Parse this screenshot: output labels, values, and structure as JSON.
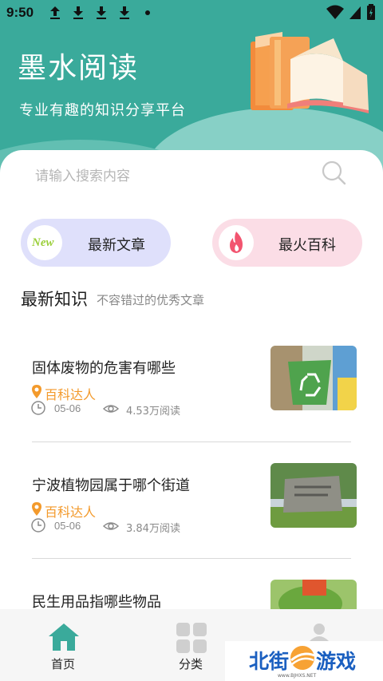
{
  "status_bar": {
    "time": "9:50"
  },
  "header": {
    "title": "墨水阅读",
    "slogan": "专业有趣的知识分享平台"
  },
  "search": {
    "placeholder": "请输入搜索内容"
  },
  "quick_links": [
    {
      "label": "最新文章",
      "badge": "New"
    },
    {
      "label": "最火百科"
    }
  ],
  "section": {
    "title": "最新知识",
    "subtitle": "不容错过的优秀文章"
  },
  "articles": [
    {
      "title": "固体废物的危害有哪些",
      "category": "百科达人",
      "date": "05-06",
      "reads": "4.53万阅读"
    },
    {
      "title": "宁波植物园属于哪个街道",
      "category": "百科达人",
      "date": "05-06",
      "reads": "3.84万阅读"
    },
    {
      "title": "民生用品指哪些物品"
    }
  ],
  "tabs": [
    {
      "label": "首页",
      "active": true
    },
    {
      "label": "分类"
    }
  ],
  "watermark": {
    "text1": "北街",
    "text2": "游戏",
    "url": "www.BJHXS.NET"
  },
  "colors": {
    "accent": "#3aaa9b",
    "category": "#f39a2c"
  }
}
